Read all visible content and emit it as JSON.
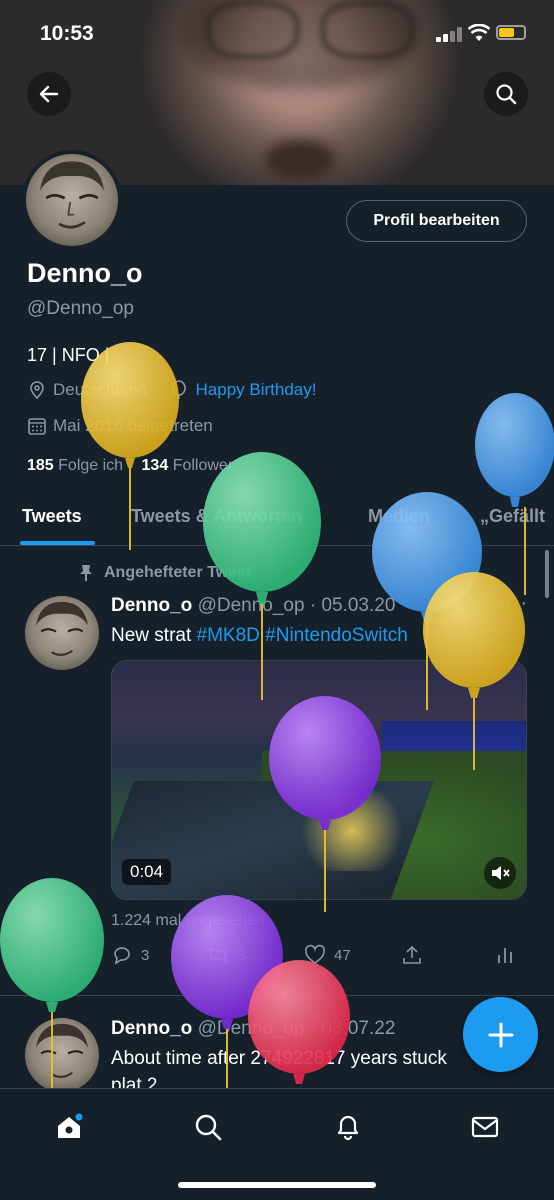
{
  "status_bar": {
    "time": "10:53"
  },
  "header": {
    "back_icon": "back-arrow-icon",
    "search_icon": "search-icon"
  },
  "profile": {
    "name": "Denno_o",
    "handle": "@Denno_op",
    "edit_label": "Profil bearbeiten",
    "bio": "17 | NFO |",
    "location": "Deutschland",
    "birthday": "Happy Birthday!",
    "joined": "Mai 2016 beigetreten",
    "following_count": "185",
    "following_label": "Folge ich",
    "followers_count": "134",
    "followers_label": "Follower"
  },
  "tabs": [
    {
      "label": "Tweets",
      "active": true
    },
    {
      "label": "Tweets & Antworten",
      "active": false
    },
    {
      "label": "Medien",
      "active": false
    },
    {
      "label": "„Gefällt",
      "active": false
    }
  ],
  "pinned_tweet": {
    "pinned_label": "Angehefteter Tweet",
    "name": "Denno_o",
    "handle": "@Denno_op",
    "date": "05.03.20",
    "text_prefix": "New strat",
    "tag1": "#MK8D",
    "tag2": "#NintendoSwitch",
    "video_duration": "0:04",
    "views": "1.224 mal angesehen",
    "replies": "3",
    "retweets": "3",
    "likes": "47"
  },
  "tweet2": {
    "name": "Denno_o",
    "handle": "@Denno_op",
    "date": "03.07.22",
    "text_line1": "About time after 274922817 years stuck",
    "text_line2": "plat 2"
  },
  "colors": {
    "background": "#15202b",
    "accent": "#1d9bf0",
    "muted": "#8b98a5",
    "divider": "#38444d"
  },
  "balloons": [
    "yellow",
    "green",
    "blue",
    "blue",
    "yellow",
    "purple",
    "green",
    "purple",
    "red"
  ],
  "bottom_nav": [
    "home-icon",
    "search-icon",
    "notifications-bell-icon",
    "messages-mail-icon"
  ]
}
